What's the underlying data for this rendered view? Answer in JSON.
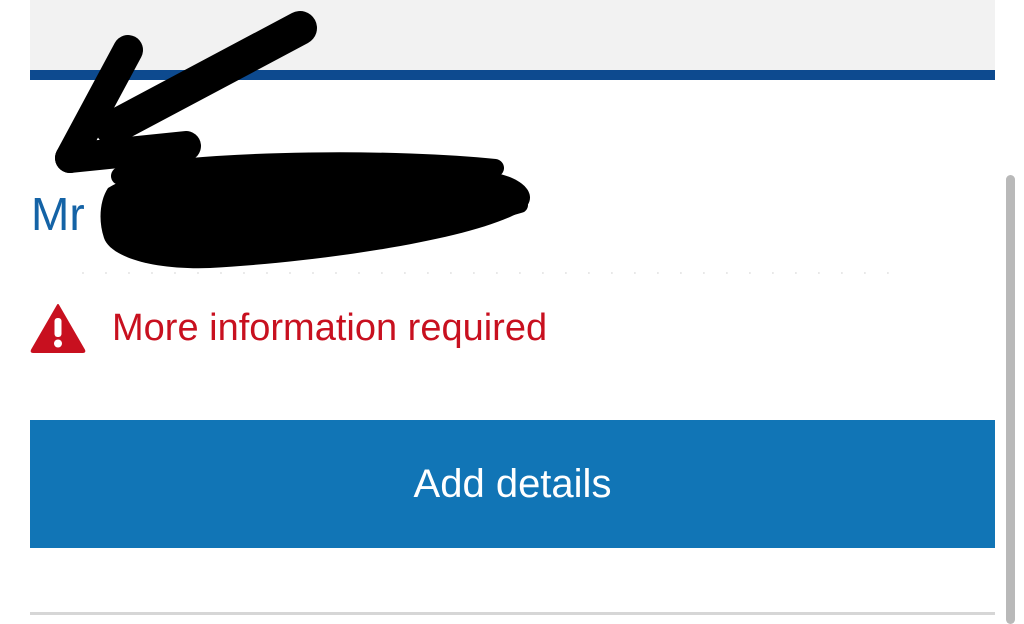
{
  "card": {
    "name_text": "Mr",
    "faint_text": "· · · · · · · · · · · · · · · · · · · · · · · · · · · · · · · · · · · ·"
  },
  "warning": {
    "icon": "warning-triangle-icon",
    "text": "More information required",
    "color": "#c8101f"
  },
  "actions": {
    "add_details_label": "Add details"
  },
  "colors": {
    "accent_blue": "#1175b6",
    "rule_blue": "#0d4a8f",
    "name_blue": "#1463a6",
    "panel_grey": "#f2f2f2"
  },
  "annotations": {
    "arrow": "black-arrow-annotation",
    "redaction": "black-redaction-scribble"
  }
}
